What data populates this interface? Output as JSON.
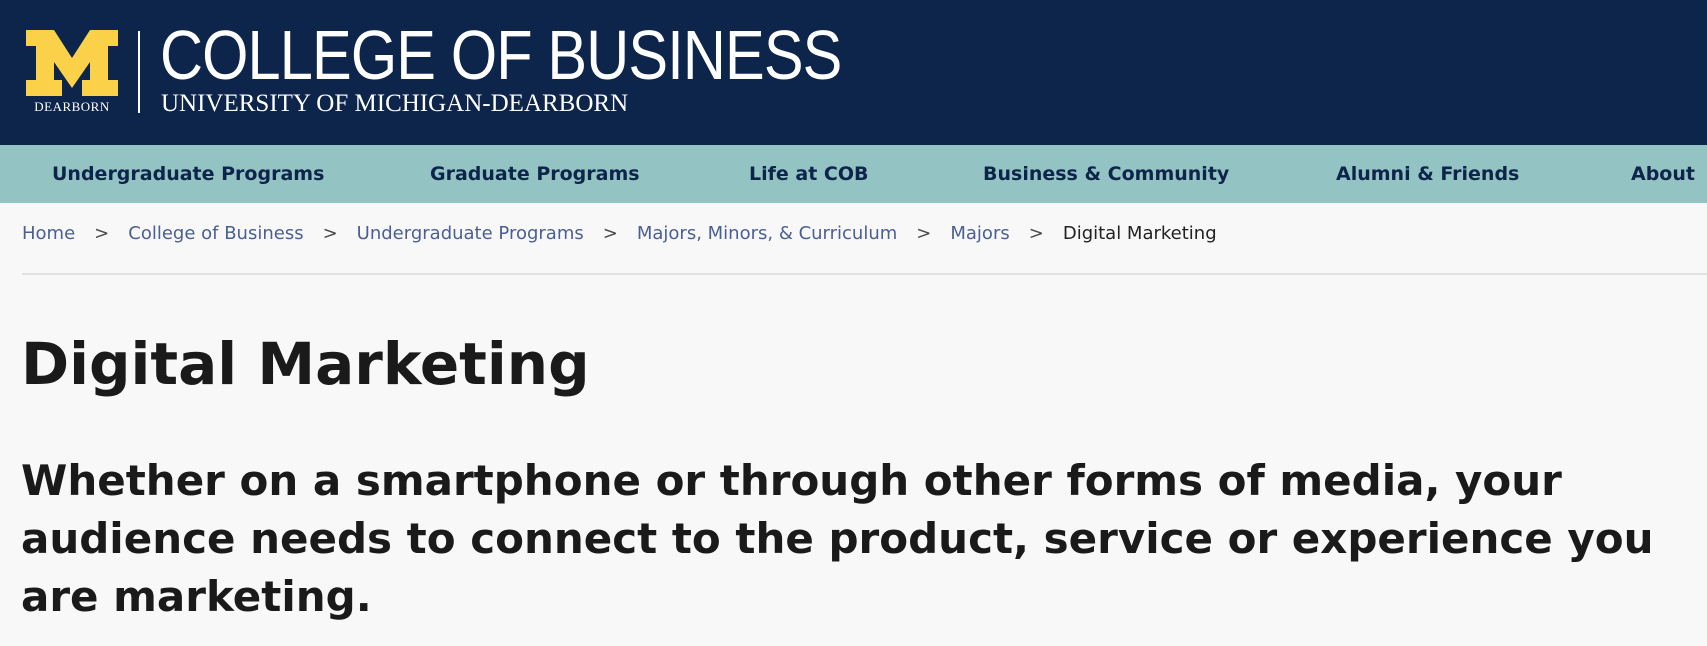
{
  "header": {
    "logo_text": "DEARBORN",
    "title": "COLLEGE OF BUSINESS",
    "subtitle": "UNIVERSITY OF MICHIGAN-DEARBORN",
    "background_color": "#0d244b",
    "logo_color": "#fcd14a"
  },
  "nav": {
    "background_color": "#93c4c3",
    "items": [
      {
        "label": "Undergraduate Programs"
      },
      {
        "label": "Graduate Programs"
      },
      {
        "label": "Life at COB"
      },
      {
        "label": "Business & Community"
      },
      {
        "label": "Alumni & Friends"
      },
      {
        "label": "About"
      }
    ]
  },
  "breadcrumb": {
    "separator": ">",
    "items": [
      {
        "label": "Home"
      },
      {
        "label": "College of Business"
      },
      {
        "label": "Undergraduate Programs"
      },
      {
        "label": "Majors, Minors, & Curriculum"
      },
      {
        "label": "Majors"
      }
    ],
    "current": "Digital Marketing"
  },
  "main": {
    "title": "Digital Marketing",
    "intro": "Whether on a smartphone or through other forms of media, your audience needs to connect to the product, service or experience you are marketing."
  }
}
